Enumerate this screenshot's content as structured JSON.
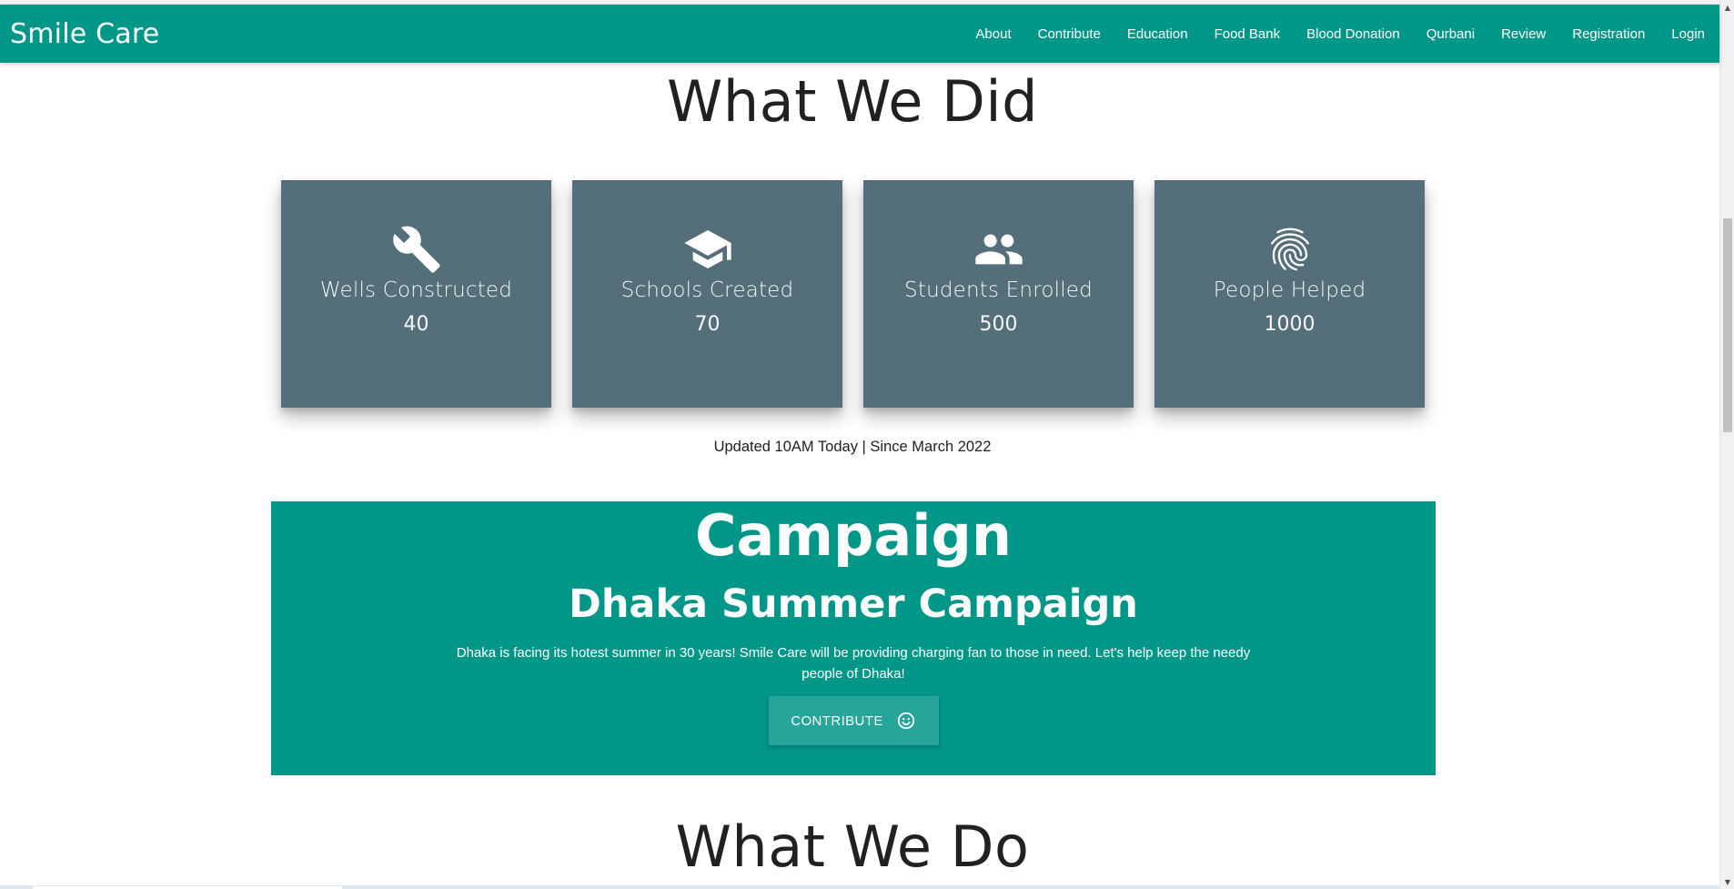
{
  "nav": {
    "brand": "Smile Care",
    "links": [
      "About",
      "Contribute",
      "Education",
      "Food Bank",
      "Blood Donation",
      "Qurbani",
      "Review",
      "Registration",
      "Login"
    ]
  },
  "what_we_did": {
    "title": "What We Did",
    "stats": [
      {
        "icon": "wrench-icon",
        "label": "Wells Constructed",
        "value": "40"
      },
      {
        "icon": "graduation-cap-icon",
        "label": "Schools Created",
        "value": "70"
      },
      {
        "icon": "people-icon",
        "label": "Students Enrolled",
        "value": "500"
      },
      {
        "icon": "fingerprint-icon",
        "label": "People Helped",
        "value": "1000"
      }
    ],
    "updated": "Updated 10AM Today | Since March 2022"
  },
  "campaign": {
    "title": "Campaign",
    "name": "Dhaka Summer Campaign",
    "description": "Dhaka is facing its hotest summer in 30 years! Smile Care will be providing charging fan to those in need. Let's help keep the needy people of Dhaka!",
    "button_label": "Contribute",
    "button_icon": "smiley-icon"
  },
  "what_we_do": {
    "title": "What We Do"
  },
  "colors": {
    "primary": "#009688",
    "card": "#546e7a",
    "button": "#26a69a"
  }
}
